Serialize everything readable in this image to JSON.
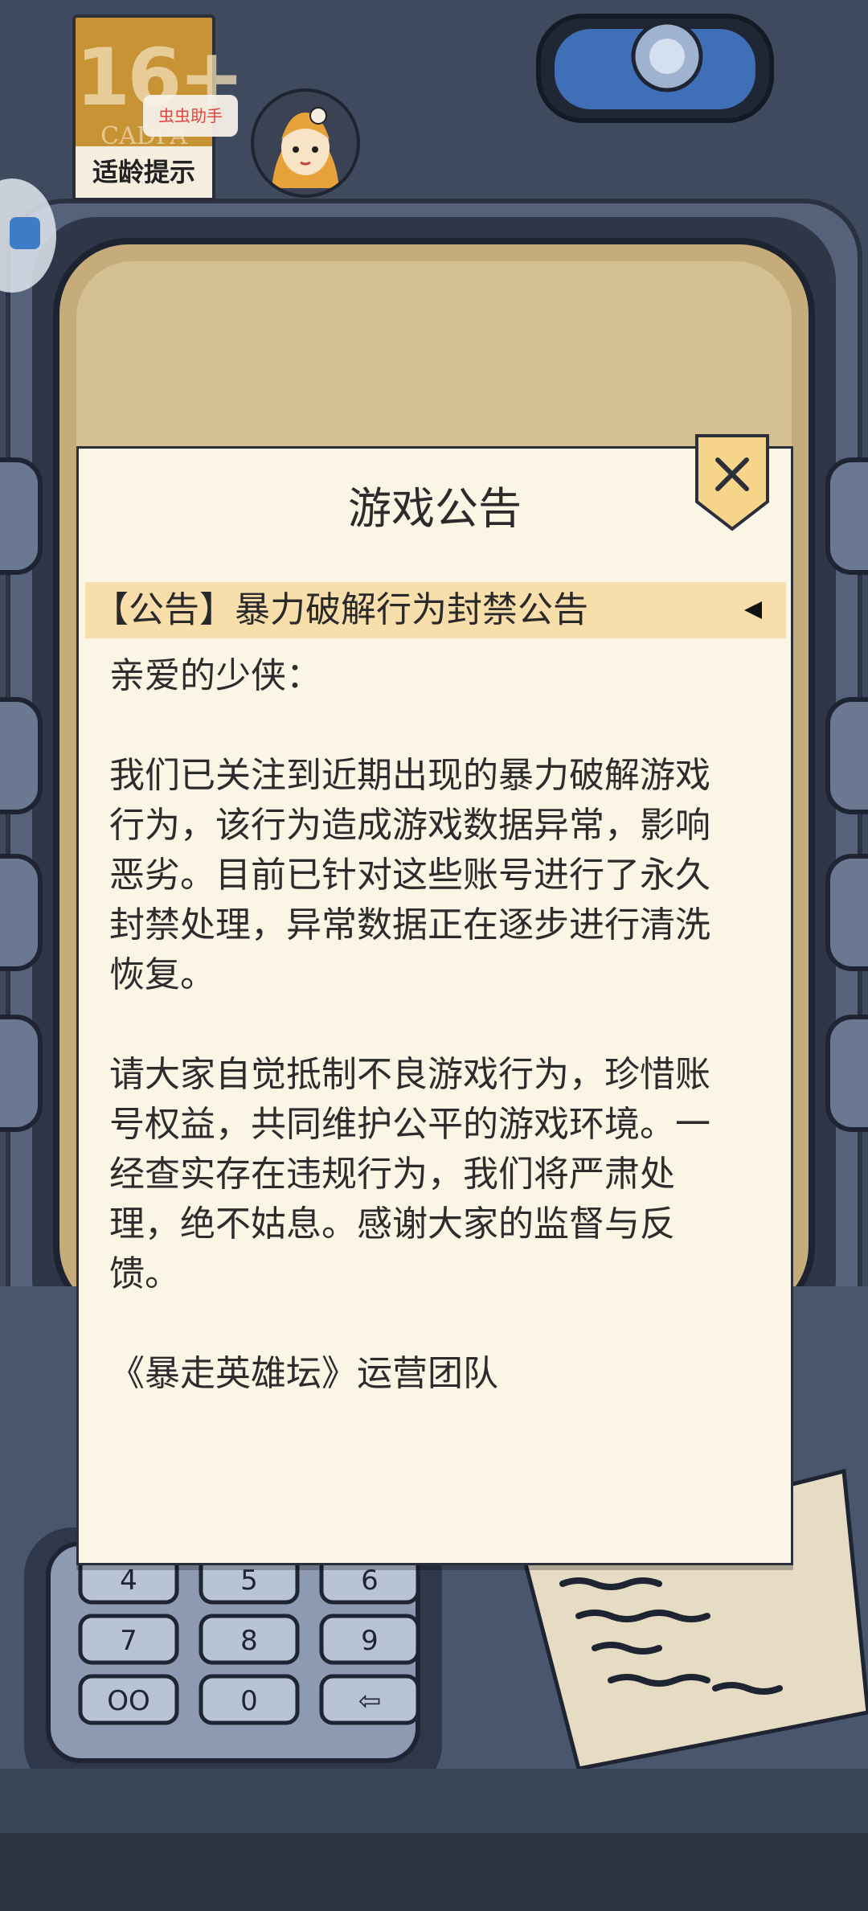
{
  "age_rating": {
    "number": "16+",
    "org": "CADPA",
    "label": "适龄提示"
  },
  "helper_tag": "虫虫助手",
  "keypad_keys": [
    "4",
    "5",
    "6",
    "7",
    "8",
    "9",
    "OO",
    "0",
    "⇦"
  ],
  "announcement": {
    "title": "游戏公告",
    "item_title": "【公告】暴力破解行为封禁公告",
    "greeting": "亲爱的少侠：",
    "paragraph1_lines": [
      "我们已关注到近期出现的暴力破解游戏",
      "行为，该行为造成游戏数据异常，影响",
      "恶劣。目前已针对这些账号进行了永久",
      "封禁处理，异常数据正在逐步进行清洗",
      "恢复。"
    ],
    "paragraph2_lines": [
      "请大家自觉抵制不良游戏行为，珍惜账",
      "号权益，共同维护公平的游戏环境。一",
      "经查实存在违规行为，我们将严肃处",
      "理，绝不姑息。感谢大家的监督与反",
      "馈。"
    ],
    "signature": "《暴走英雄坛》运营团队"
  },
  "colors": {
    "dialog_bg": "#fbf5e6",
    "highlight_bar": "#f8deaa",
    "badge_orange": "#c79334"
  }
}
